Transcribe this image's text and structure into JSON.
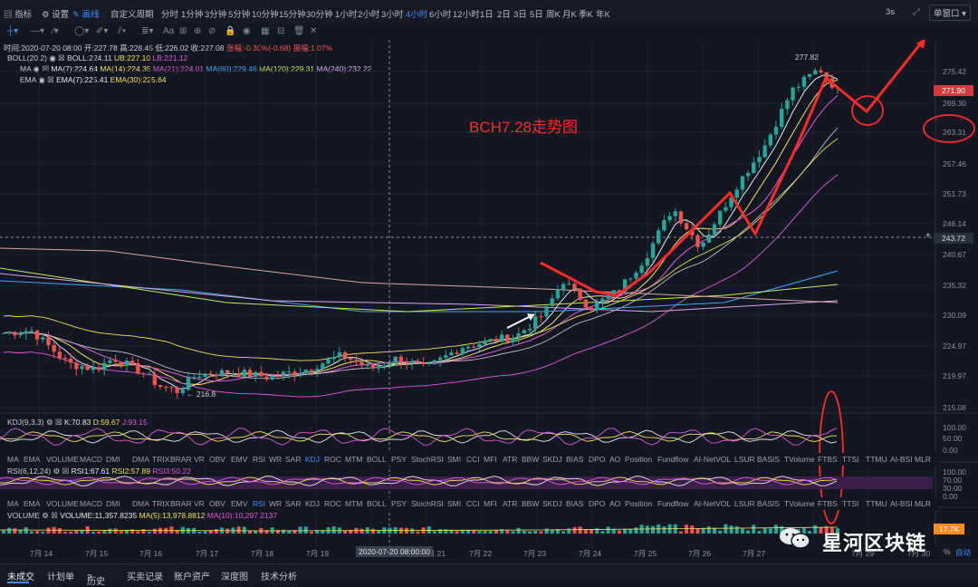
{
  "topbar": {
    "items": [
      {
        "label": "指标"
      },
      {
        "label": "设置"
      },
      {
        "label": "画线"
      },
      {
        "label": "自定义周期"
      },
      {
        "label": "分时"
      },
      {
        "label": "1分钟"
      },
      {
        "label": "3分钟"
      },
      {
        "label": "5分钟"
      },
      {
        "label": "10分钟"
      },
      {
        "label": "15分钟"
      },
      {
        "label": "30分钟"
      },
      {
        "label": "1小时"
      },
      {
        "label": "2小时"
      },
      {
        "label": "3小时"
      },
      {
        "label": "4小时"
      },
      {
        "label": "6小时"
      },
      {
        "label": "12小时"
      },
      {
        "label": "1日"
      },
      {
        "label": "2日"
      },
      {
        "label": "3日"
      },
      {
        "label": "5日"
      },
      {
        "label": "周K"
      },
      {
        "label": "月K"
      },
      {
        "label": "季K"
      },
      {
        "label": "年K"
      }
    ],
    "active": "4小时",
    "refresh": "3s",
    "window_mode": "单窗口"
  },
  "info_line": {
    "time": "时间:2020-07-20 08:00",
    "open": "开:227.78",
    "high": "高:228.45",
    "low": "低:226.02",
    "close": "收:227.08",
    "change": "涨幅:-0.30%(-0.68)",
    "amplitude": "振幅:1.07%"
  },
  "indicators": {
    "boll": {
      "name": "BOLL(20,2)",
      "mid": "BOLL:224.11",
      "ub": "UB:227.10",
      "lb": "LB:221.12"
    },
    "ma": {
      "name": "MA",
      "ma7": "MA(7):224.64",
      "ma14": "MA(14):224.35",
      "ma21": "MA(21):224.01",
      "ma60": "MA(60):229.46",
      "ma120": "MA(120):229.31",
      "ma240": "MA(240):232.22"
    },
    "ema": {
      "name": "EMA",
      "ema7": "EMA(7):225.41",
      "ema30": "EMA(30):225.64"
    },
    "kdj": {
      "name": "KDJ(9,3,3)",
      "k": "K:70.83",
      "d": "D:59.67",
      "j": "J:93.15"
    },
    "rsi": {
      "name": "RSI(6,12,24)",
      "r1": "RSI1:67.61",
      "r2": "RSI2:57.89",
      "r3": "RSI3:50.22"
    },
    "volume": {
      "name": "VOLUME",
      "vol": "VOLUME:11,357.8235",
      "ma5": "MA(5):13,978.8812",
      "ma10": "MA(10):10,297.2137"
    }
  },
  "chart_title": "BCH7.28走势图",
  "price_axis": [
    "275.42",
    "269.30",
    "263.31",
    "257.46",
    "251.73",
    "246.14",
    "240.67",
    "235.32",
    "230.09",
    "224.97",
    "219.97",
    "215.08"
  ],
  "current_price": "271.90",
  "crosshair_price": "243.72",
  "high_label": "277.82",
  "low_label": "216.8",
  "kdj_axis": [
    "100.00",
    "50.00",
    "0.00"
  ],
  "rsi_axis": [
    "100.00",
    "70.00",
    "30.00",
    "0.00"
  ],
  "volume_tag": "17.7K",
  "tab_items": [
    "MA",
    "EMA",
    "VOLUME",
    "MACD",
    "DMI",
    "DMA",
    "TRIX",
    "BRAR",
    "VR",
    "OBV",
    "EMV",
    "RSI",
    "WR",
    "SAR",
    "KDJ",
    "ROC",
    "MTM",
    "BOLL",
    "PSY",
    "StochRSI",
    "SMI",
    "CCI",
    "MFI",
    "ATR",
    "BBW",
    "SKDJ",
    "BIAS",
    "DPO",
    "AO",
    "Position",
    "Fundflow",
    "AI-NetVOL",
    "LSUR",
    "BASIS",
    "TVolume",
    "FTBS",
    "TTSI",
    "TTMU",
    "AI-BSI",
    "MLR"
  ],
  "time_axis": [
    "7月 14",
    "7月 15",
    "7月 16",
    "7月 17",
    "7月 18",
    "7月 19",
    "7月 21",
    "7月 22",
    "7月 23",
    "7月 24",
    "7月 25",
    "7月 26",
    "7月 27",
    "7月 29",
    "7月 30"
  ],
  "time_cursor": "2020-07-20 08:00:00",
  "zoom_pct": "%",
  "auto_label": "自动",
  "watermark": "星河区块链",
  "bottom_tabs": [
    "未成交",
    "计划单",
    "历史",
    "买卖记录",
    "账户资产",
    "深度图",
    "技术分析"
  ],
  "colors": {
    "up": "#26a69a",
    "down": "#ef5350",
    "accent": "#3c8cff",
    "annotation": "#ff2a2a"
  }
}
